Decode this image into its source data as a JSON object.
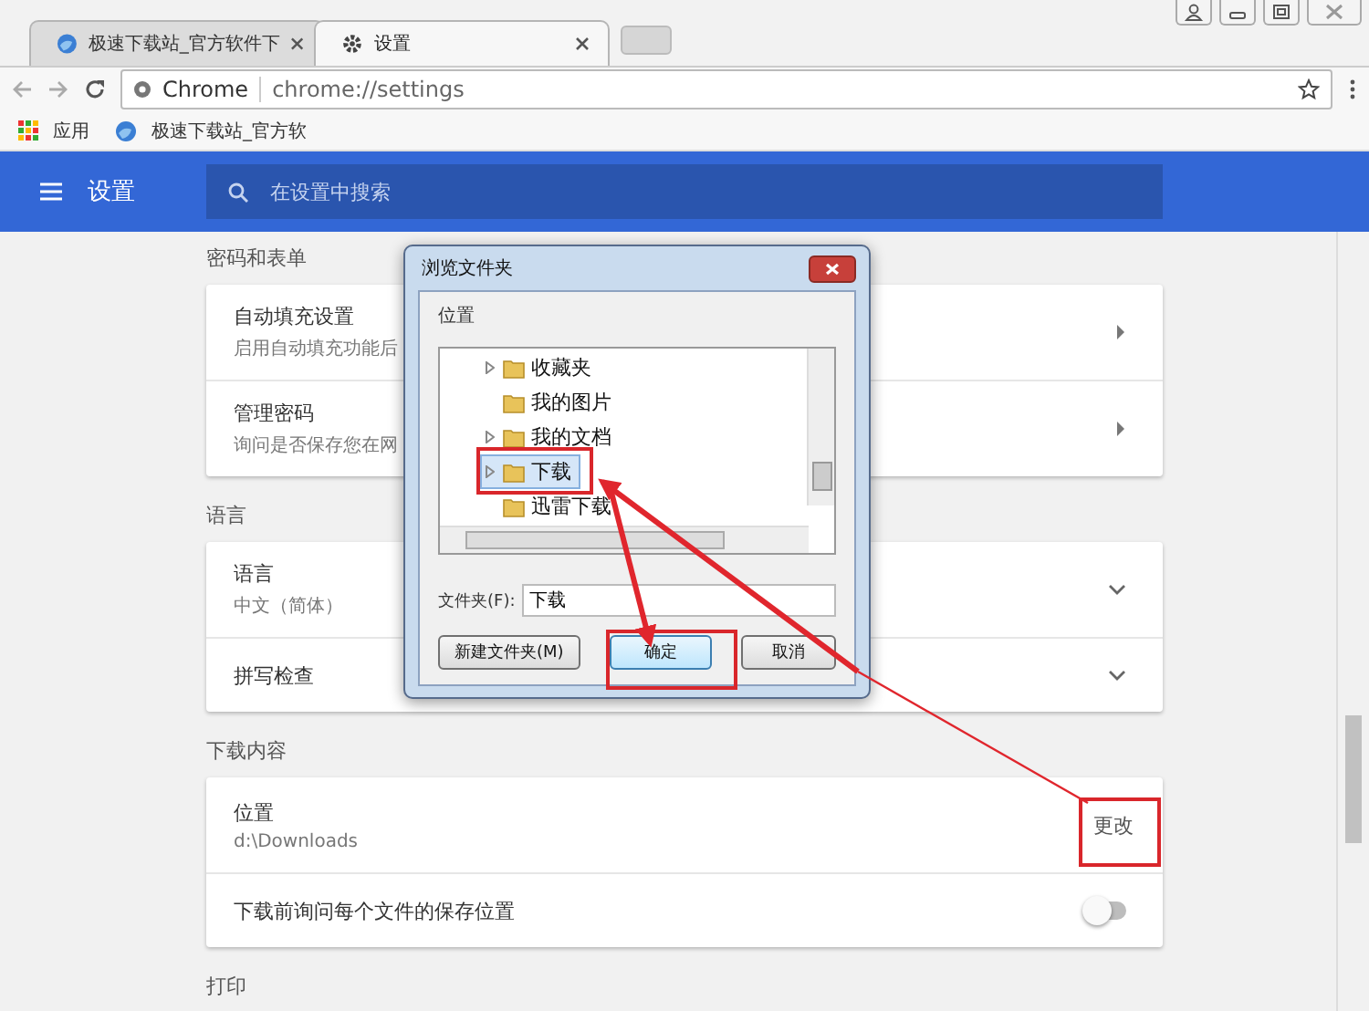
{
  "browser": {
    "tabs": [
      {
        "title": "极速下载站_官方软件下",
        "selected": false
      },
      {
        "title": "设置",
        "selected": true
      }
    ],
    "address": {
      "site_label": "Chrome",
      "url": "chrome://settings"
    },
    "bookmarks": [
      {
        "label": "应用"
      },
      {
        "label": "极速下载站_官方软"
      }
    ]
  },
  "header": {
    "title": "设置",
    "search_placeholder": "在设置中搜索"
  },
  "sections": [
    {
      "title": "密码和表单",
      "rows": [
        {
          "kind": "link",
          "label": "自动填充设置",
          "detail": "启用自动填充功能后"
        },
        {
          "kind": "link",
          "label": "管理密码",
          "detail": "询问是否保存您在网"
        }
      ]
    },
    {
      "title": "语言",
      "rows": [
        {
          "kind": "expand",
          "label": "语言",
          "detail": "中文（简体）"
        },
        {
          "kind": "expand",
          "label": "拼写检查"
        }
      ]
    },
    {
      "title": "下载内容",
      "rows": [
        {
          "kind": "action",
          "label": "位置",
          "detail": "d:\\Downloads",
          "action": "更改"
        },
        {
          "kind": "toggle",
          "label": "下载前询问每个文件的保存位置",
          "on": false
        }
      ]
    },
    {
      "title": "打印"
    }
  ],
  "dialog": {
    "title": "浏览文件夹",
    "prompt": "位置",
    "folders": [
      {
        "name": "收藏夹",
        "expandable": true,
        "selected": false
      },
      {
        "name": "我的图片",
        "expandable": false,
        "selected": false
      },
      {
        "name": "我的文档",
        "expandable": true,
        "selected": false
      },
      {
        "name": "下载",
        "expandable": true,
        "selected": true
      },
      {
        "name": "迅雷下载",
        "expandable": false,
        "selected": false
      }
    ],
    "folder_label": "文件夹(F):",
    "folder_value": "下载",
    "buttons": [
      {
        "label": "新建文件夹(M)",
        "kind": "secondary"
      },
      {
        "label": "确定",
        "kind": "default"
      },
      {
        "label": "取消",
        "kind": "secondary"
      }
    ]
  }
}
